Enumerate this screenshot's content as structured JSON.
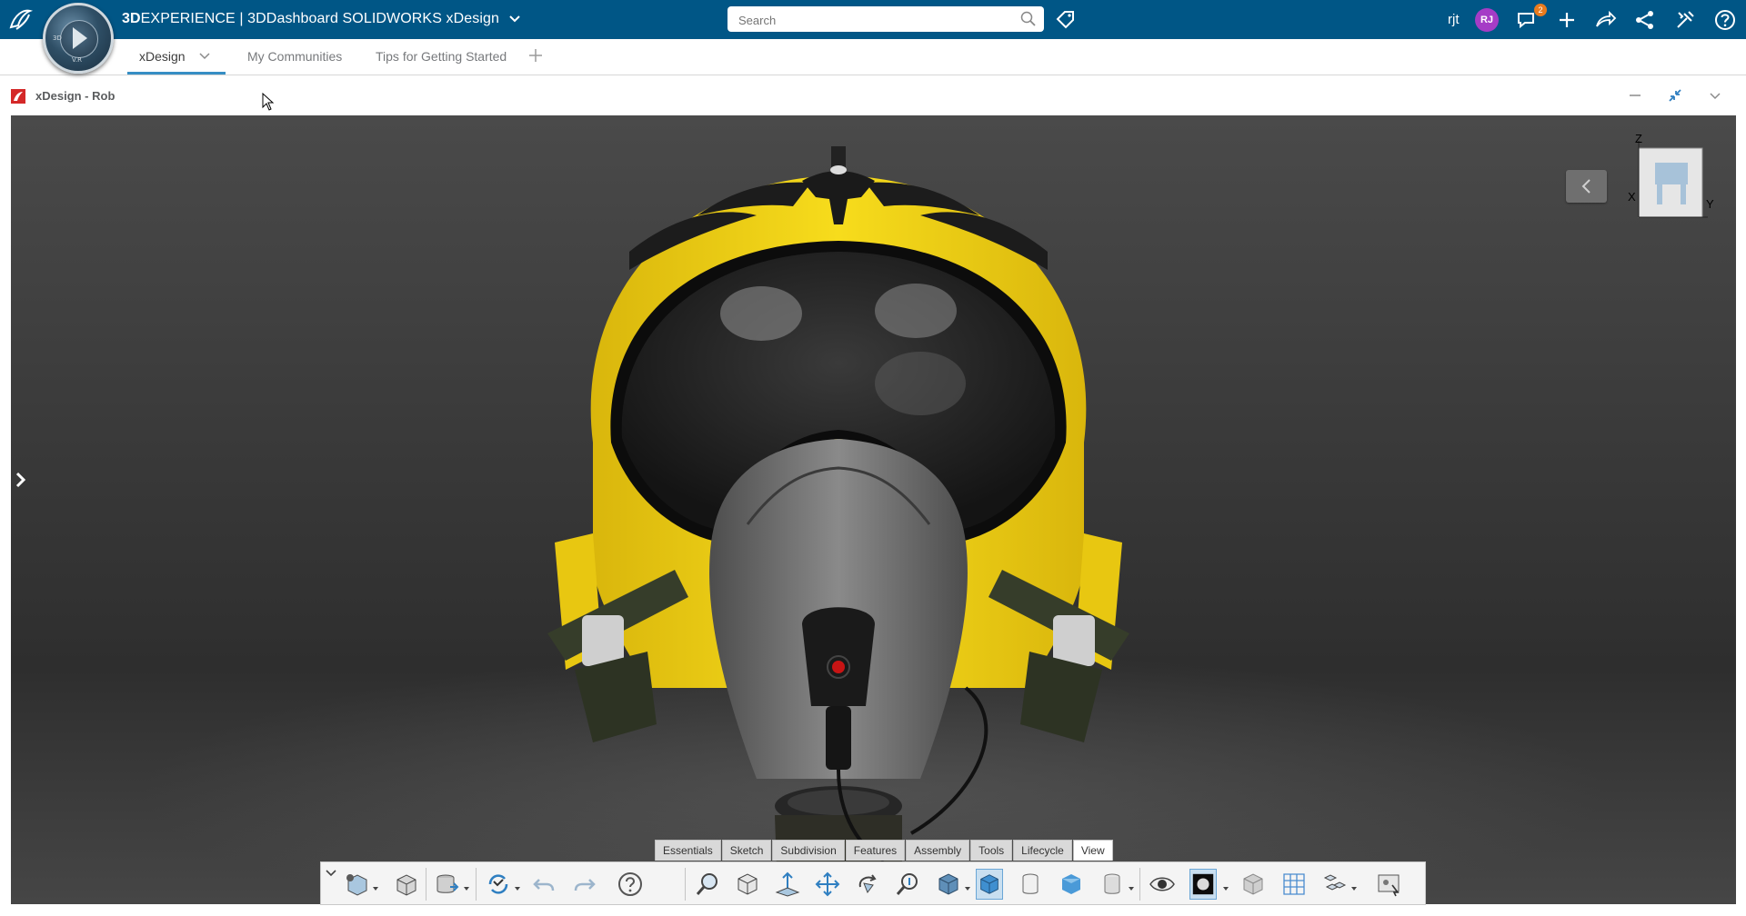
{
  "topbar": {
    "brand_bold": "3D",
    "brand_rest": "EXPERIENCE | 3DDashboard  SOLIDWORKS xDesign",
    "search_placeholder": "Search",
    "user_name": "rjt",
    "avatar_initials": "RJ",
    "notification_count": "2",
    "compass_labels": {
      "left": "3D",
      "bottom": "V.R"
    }
  },
  "tabs": [
    {
      "label": "xDesign"
    },
    {
      "label": "My Communities"
    },
    {
      "label": "Tips for Getting Started"
    }
  ],
  "widget": {
    "title": "xDesign - Rob"
  },
  "viewcube": {
    "axis_z": "Z",
    "axis_x": "X",
    "axis_y": "Y"
  },
  "command_tabs": [
    {
      "label": "Essentials"
    },
    {
      "label": "Sketch"
    },
    {
      "label": "Subdivision"
    },
    {
      "label": "Features"
    },
    {
      "label": "Assembly"
    },
    {
      "label": "Tools"
    },
    {
      "label": "Lifecycle"
    },
    {
      "label": "View",
      "active": true
    }
  ],
  "toolbar_icons": [
    "new-component-icon",
    "part-icon",
    "save-icon",
    "sync-icon",
    "undo-icon",
    "redo-icon",
    "help-icon",
    "zoom-to-area-icon",
    "standard-views-icon",
    "normal-to-icon",
    "pan-icon",
    "rotate-icon",
    "zoom-icon",
    "view-orientation-icon",
    "shaded-icon",
    "cylinder-view-icon",
    "shaded-edges-icon",
    "section-view-icon",
    "visibility-icon",
    "appearance-icon",
    "perspective-icon",
    "grid-icon",
    "explode-icon",
    "screen-capture-icon"
  ],
  "colors": {
    "topbar": "#005686",
    "accent": "#368ec4",
    "helmet_yellow": "#f2d416",
    "viewport_bg": "#3c3c3c"
  }
}
